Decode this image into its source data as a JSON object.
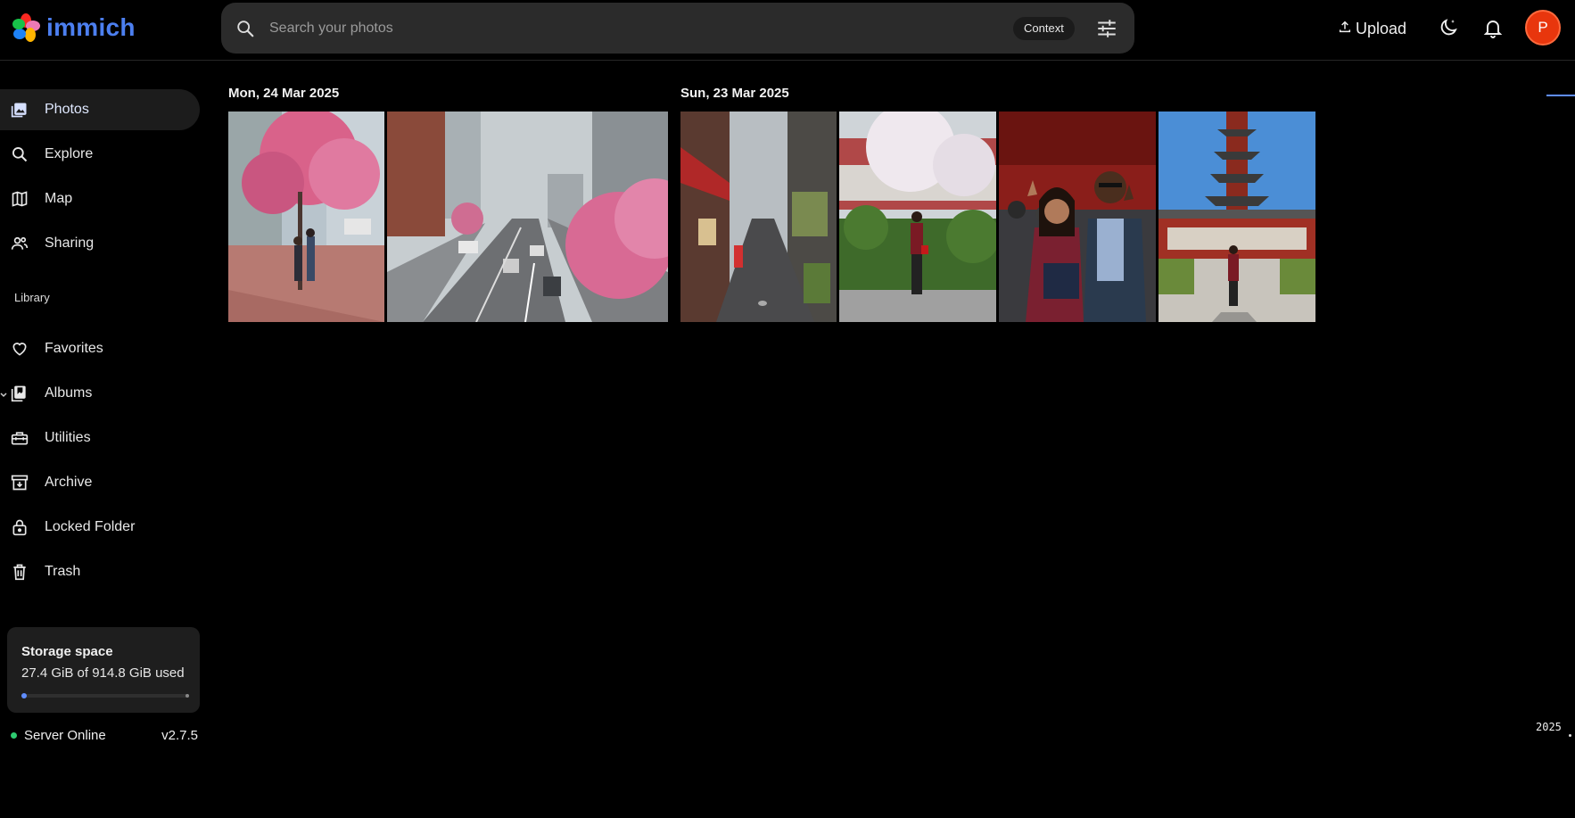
{
  "app": {
    "name": "immich",
    "logo_icon": "immich-logo-icon"
  },
  "search": {
    "placeholder": "Search your photos",
    "value": "",
    "context_label": "Context",
    "search_icon": "search-icon",
    "filter_icon": "tune-icon"
  },
  "header": {
    "upload_label": "Upload",
    "upload_icon": "upload-icon",
    "theme_icon": "moon-icon",
    "notification_icon": "bell-icon",
    "avatar_initial": "P",
    "avatar_color": "#e8360d"
  },
  "sidebar": {
    "items": [
      {
        "label": "Photos",
        "icon": "photos-icon",
        "active": true
      },
      {
        "label": "Explore",
        "icon": "search-icon"
      },
      {
        "label": "Map",
        "icon": "map-icon"
      },
      {
        "label": "Sharing",
        "icon": "people-icon"
      }
    ],
    "library_heading": "Library",
    "library_items": [
      {
        "label": "Favorites",
        "icon": "heart-icon"
      },
      {
        "label": "Albums",
        "icon": "album-icon"
      },
      {
        "label": "Utilities",
        "icon": "toolbox-icon"
      },
      {
        "label": "Archive",
        "icon": "archive-icon"
      },
      {
        "label": "Locked Folder",
        "icon": "lock-icon"
      },
      {
        "label": "Trash",
        "icon": "trash-icon"
      }
    ],
    "storage": {
      "title": "Storage space",
      "usage_text": "27.4 GiB of 914.8 GiB used",
      "used_fraction": 0.03
    },
    "server": {
      "status": "Server Online",
      "version": "v2.7.5",
      "status_color": "#2ecc71"
    }
  },
  "timeline": {
    "groups": [
      {
        "date": "Mon, 24 Mar 2025",
        "photo_count": 2
      },
      {
        "date": "Sun, 23 Mar 2025",
        "photo_count": 4
      }
    ],
    "scrubber_year": "2025"
  },
  "colors": {
    "accent": "#5f8dff",
    "background": "#000000",
    "panel": "#1e1e1e"
  }
}
